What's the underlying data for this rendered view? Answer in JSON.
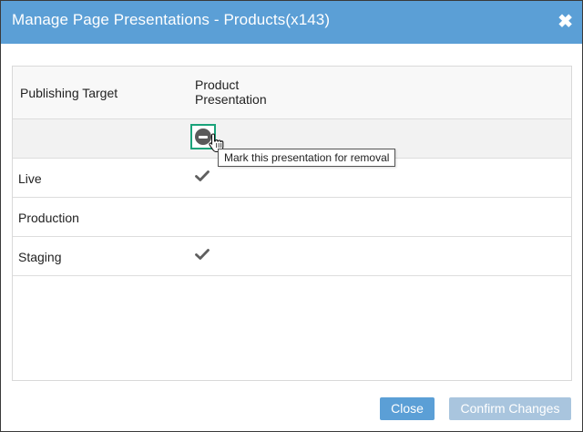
{
  "dialog": {
    "title": "Manage Page Presentations - Products(x143)",
    "close_icon": "close-icon"
  },
  "table": {
    "headers": {
      "target": "Publishing Target",
      "presentation": "Product\nPresentation"
    },
    "remove_icon": "minus-circle-icon",
    "tooltip": "Mark this presentation for removal",
    "rows": [
      {
        "label": "Live",
        "checked": true
      },
      {
        "label": "Production",
        "checked": false
      },
      {
        "label": "Staging",
        "checked": true
      }
    ]
  },
  "buttons": {
    "close": "Close",
    "confirm": "Confirm Changes"
  },
  "colors": {
    "titlebar": "#5b9fd6",
    "remove_focus": "#1aa37a",
    "confirm_disabled": "#a9c5de"
  }
}
